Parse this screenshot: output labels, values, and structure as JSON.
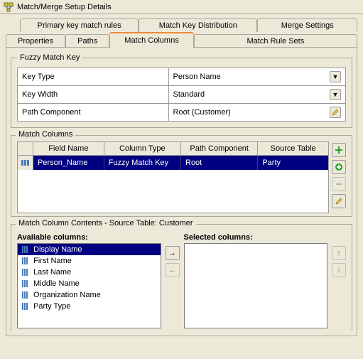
{
  "window": {
    "title": "Match/Merge Setup Details"
  },
  "tabs": {
    "row1": [
      "Primary key match rules",
      "Match Key Distribution",
      "Merge Settings"
    ],
    "row2": [
      "Properties",
      "Paths",
      "Match Columns",
      "Match Rule Sets"
    ],
    "active": "Match Columns"
  },
  "fuzzy": {
    "legend": "Fuzzy Match Key",
    "rows": {
      "keyType": {
        "label": "Key Type",
        "value": "Person Name"
      },
      "keyWidth": {
        "label": "Key Width",
        "value": "Standard"
      },
      "pathComp": {
        "label": "Path Component",
        "value": "Root (Customer)"
      }
    }
  },
  "matchColumns": {
    "legend": "Match Columns",
    "headers": [
      "Field Name",
      "Column Type",
      "Path Component",
      "Source Table"
    ],
    "rows": [
      {
        "field": "Person_Name",
        "ctype": "Fuzzy Match Key",
        "path": "Root",
        "src": "Party"
      }
    ]
  },
  "contents": {
    "legend": "Match Column Contents - Source Table: Customer",
    "availableLabel": "Available columns:",
    "selectedLabel": "Selected columns:",
    "available": [
      "Display Name",
      "First Name",
      "Last Name",
      "Middle Name",
      "Organization Name",
      "Party Type"
    ],
    "selected": []
  },
  "colors": {
    "selBg": "#000080",
    "selFg": "#ffffff"
  }
}
